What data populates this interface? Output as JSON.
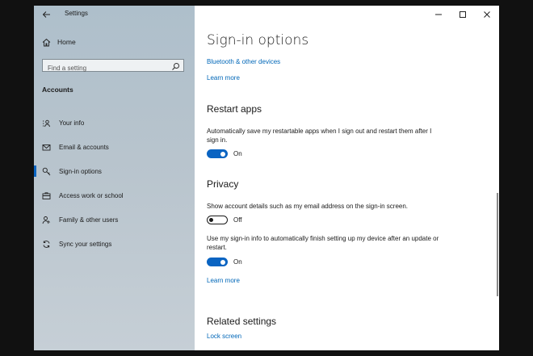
{
  "app": {
    "title": "Settings"
  },
  "sidebar": {
    "home_label": "Home",
    "search_placeholder": "Find a setting",
    "section_label": "Accounts",
    "items": [
      {
        "label": "Your info",
        "icon": "person-card-icon"
      },
      {
        "label": "Email & accounts",
        "icon": "mail-icon"
      },
      {
        "label": "Sign-in options",
        "icon": "key-icon",
        "active": true
      },
      {
        "label": "Access work or school",
        "icon": "briefcase-icon"
      },
      {
        "label": "Family & other users",
        "icon": "people-icon"
      },
      {
        "label": "Sync your settings",
        "icon": "sync-icon"
      }
    ]
  },
  "main": {
    "page_title": "Sign-in options",
    "bluetooth_link": "Bluetooth & other devices",
    "learn_more_1": "Learn more",
    "restart_apps": {
      "heading": "Restart apps",
      "description": "Automatically save my restartable apps when I sign out and restart them after I sign in.",
      "toggle_state": "On"
    },
    "privacy": {
      "heading": "Privacy",
      "account_details_desc": "Show account details such as my email address on the sign-in screen.",
      "account_details_state": "Off",
      "signin_info_desc": "Use my sign-in info to automatically finish setting up my device after an update or restart.",
      "signin_info_state": "On",
      "learn_more": "Learn more"
    },
    "related": {
      "heading": "Related settings",
      "lock_screen_link": "Lock screen"
    }
  },
  "colors": {
    "accent": "#0a64c2",
    "link": "#0067b8"
  }
}
